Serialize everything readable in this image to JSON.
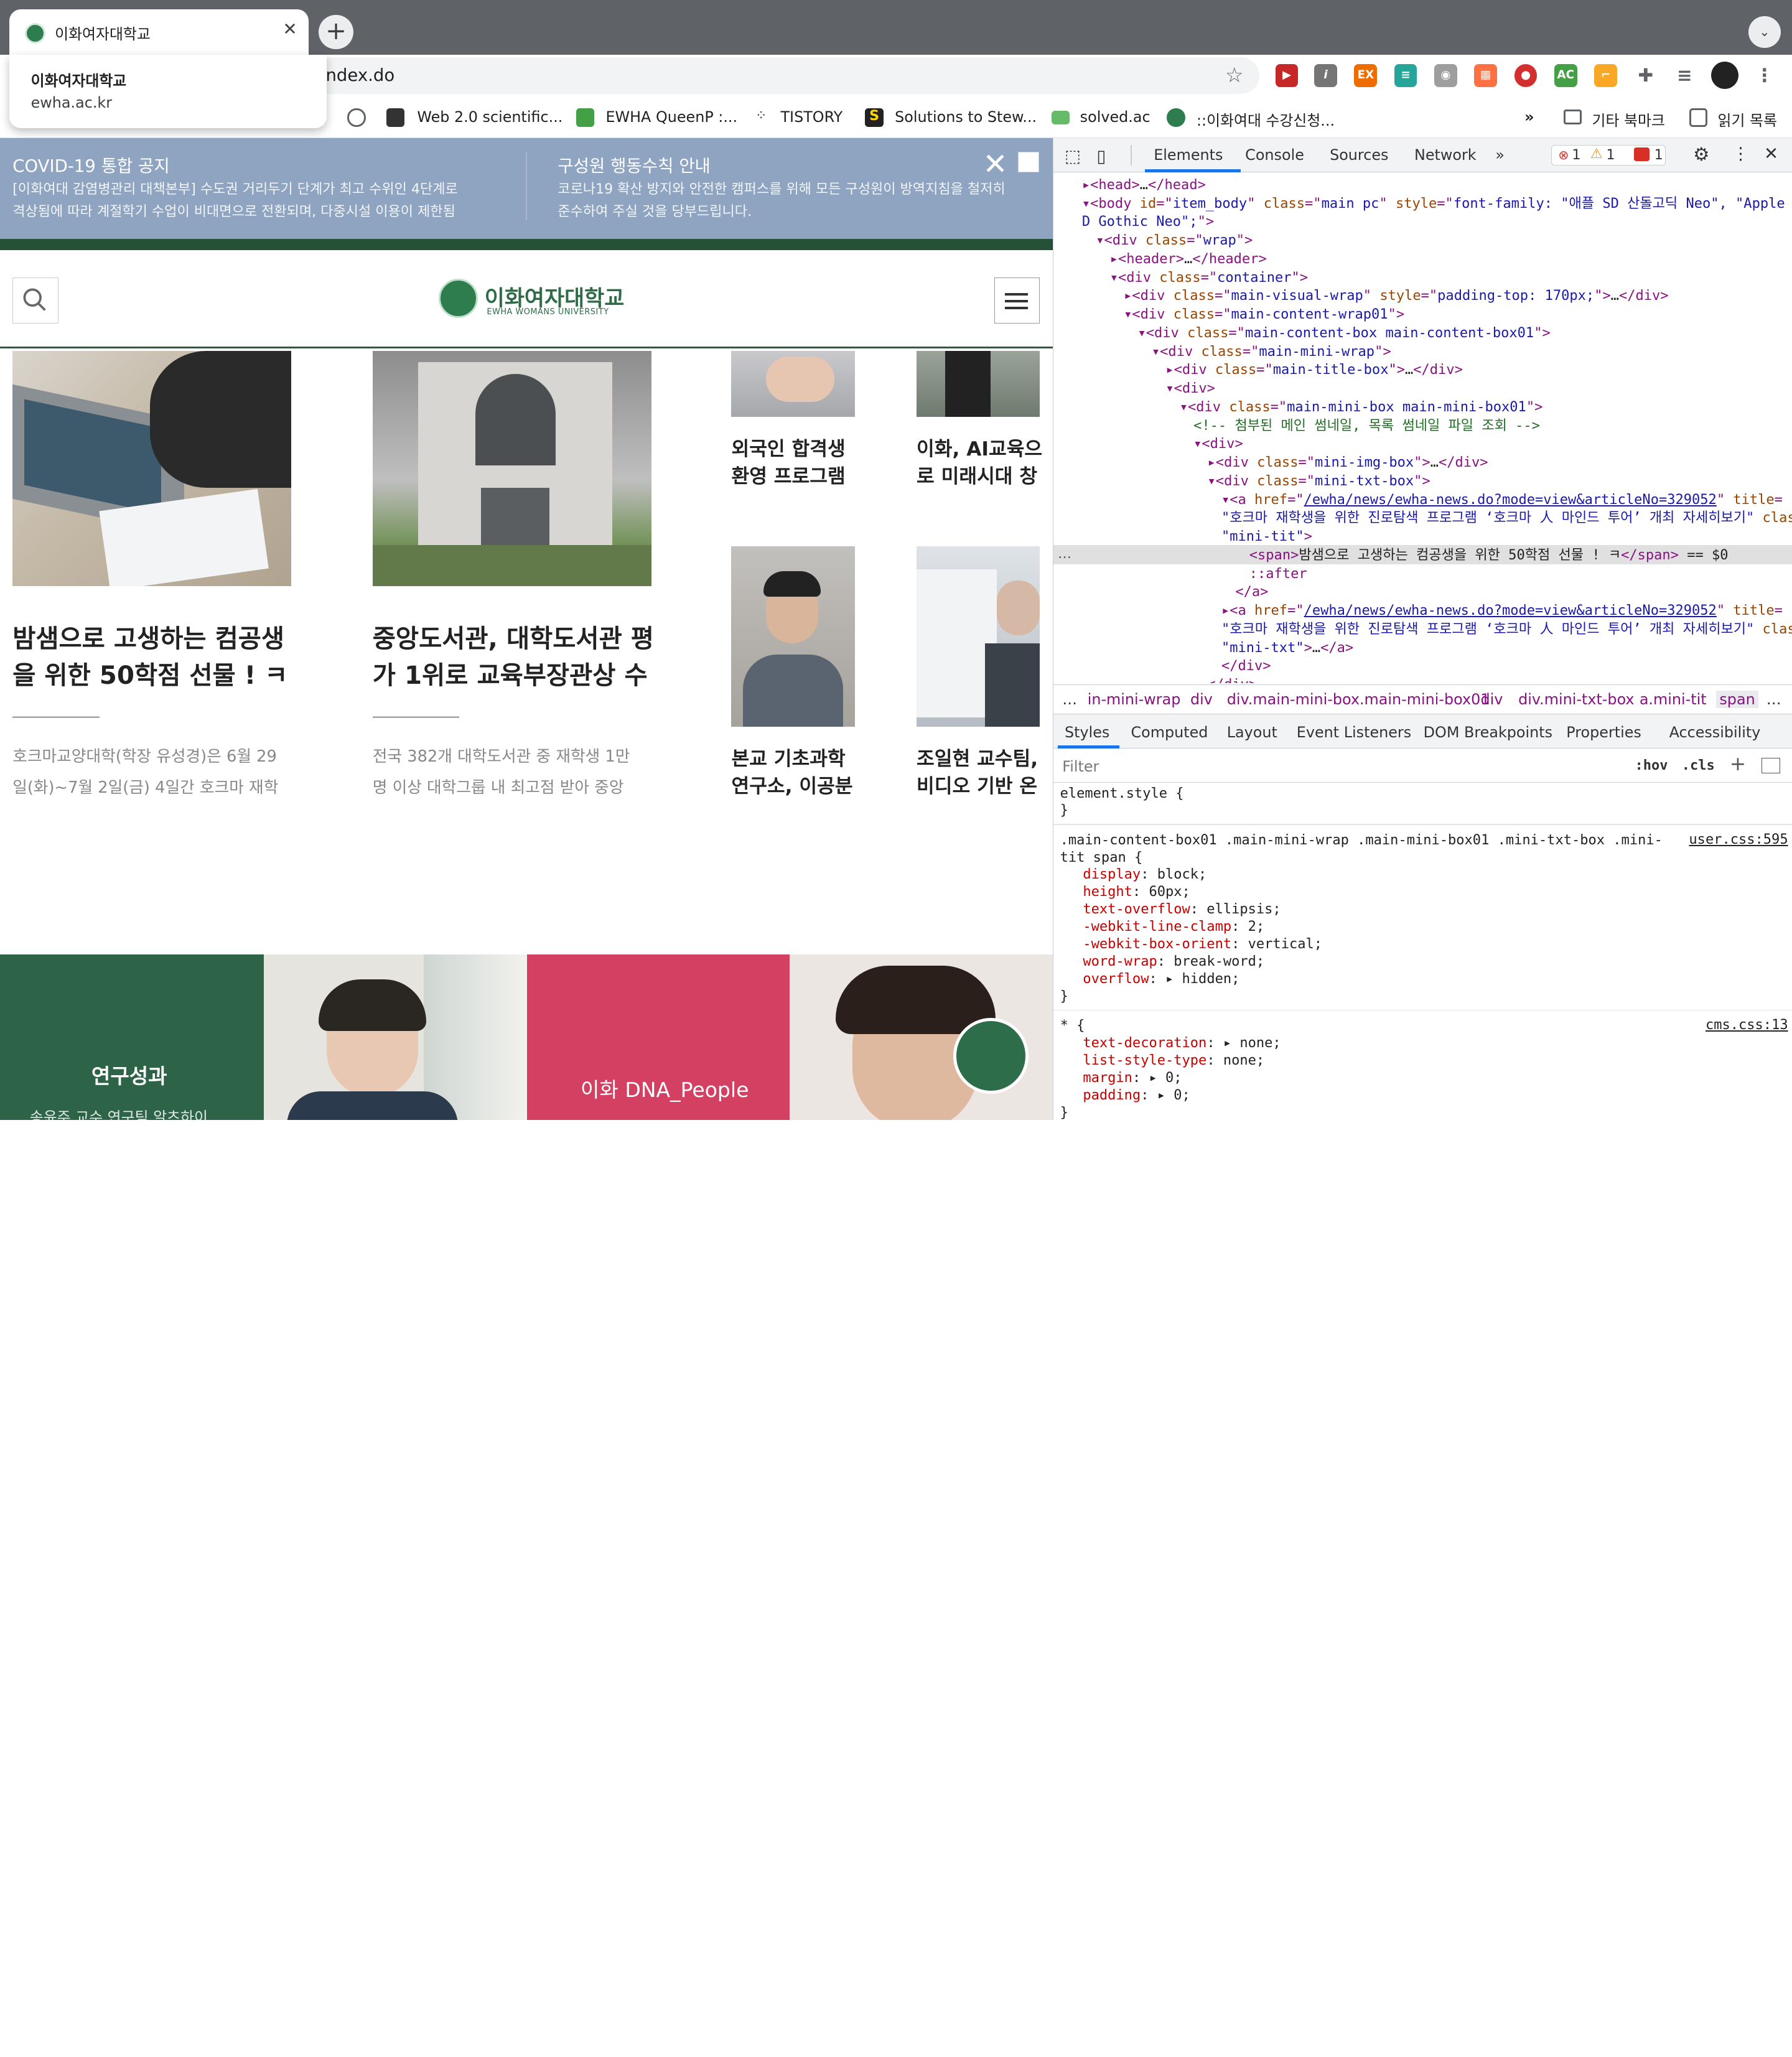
{
  "browser": {
    "tab_title": "이화여자대학교",
    "tab_close": "✕",
    "new_tab": "+",
    "tab_menu": "⌄",
    "tooltip": {
      "title": "이화여자대학교",
      "domain": "ewha.ac.kr"
    },
    "url_fragment": "ndex.do",
    "bookmarks": [
      "Web 2.0 scientific...",
      "EWHA QueenP :...",
      "TISTORY",
      "Solutions to Stew...",
      "solved.ac",
      "::이화여대 수강신청..."
    ],
    "bookmarks_more": "»",
    "other_bookmarks": "기타 북마크",
    "reading_list": "읽기 목록"
  },
  "page": {
    "notices": [
      {
        "title": "COVID-19 통합 공지",
        "text": [
          "[이화여대 감염병관리 대책본부] 수도권 거리두기 단계가 최고 수위인 4단계로",
          "격상됨에 따라 계절학기 수업이 비대면으로 전환되며, 다중시설 이용이 제한됨"
        ]
      },
      {
        "title": "구성원 행동수칙 안내",
        "text": [
          "코로나19 확산 방지와 안전한 캠퍼스를 위해 모든 구성원이 방역지침을 철저히",
          "준수하여 주실 것을 당부드립니다."
        ]
      }
    ],
    "notice_close": "✕",
    "logo_ko": "이화여자대학교",
    "logo_en": "EWHA WOMANS UNIVERSITY",
    "news_big": [
      {
        "title": [
          "밤샘으로 고생하는 컴공생",
          "을 위한 50학점 선물 ! ㅋ"
        ],
        "desc": [
          "호크마교양대학(학장 유성경)은 6월 29",
          "일(화)~7월 2일(금) 4일간 호크마 재학"
        ]
      },
      {
        "title": [
          "중앙도서관, 대학도서관 평",
          "가 1위로 교육부장관상 수"
        ],
        "desc": [
          "전국 382개 대학도서관 중 재학생 1만",
          "명 이상 대학그룹 내 최고점 받아 중앙"
        ]
      }
    ],
    "news_small": [
      {
        "title": [
          "외국인 합격생",
          "환영 프로그램"
        ]
      },
      {
        "title": [
          "이화, AI교육으",
          "로 미래시대 창"
        ]
      },
      {
        "title": [
          "본교 기초과학",
          "연구소, 이공분"
        ]
      },
      {
        "title": [
          "조일현 교수팀,",
          "비디오 기반 온"
        ]
      }
    ],
    "band_labels": [
      "연구성과",
      "이화 DNA_People"
    ],
    "band_sub": "송윤주 교수 연구팀 알츠하이"
  },
  "devtools": {
    "tabs": [
      "Elements",
      "Console",
      "Sources",
      "Network",
      "»"
    ],
    "errors": "1",
    "warnings": "1",
    "issues": "1",
    "dom": [
      {
        "indent": 1,
        "segs": [
          [
            "tg",
            "▸<head>"
          ],
          [
            "tx",
            "…"
          ],
          [
            "tg",
            "</head>"
          ]
        ]
      },
      {
        "indent": 1,
        "segs": [
          [
            "tg",
            "▾<body "
          ],
          [
            "at",
            "id"
          ],
          [
            "tg",
            "=\""
          ],
          [
            "av",
            "item_body"
          ],
          [
            "tg",
            "\" "
          ],
          [
            "at",
            "class"
          ],
          [
            "tg",
            "=\""
          ],
          [
            "av",
            "main pc"
          ],
          [
            "tg",
            "\" "
          ],
          [
            "at",
            "style"
          ],
          [
            "tg",
            "=\""
          ],
          [
            "av",
            "font-family: \"애플 SD 산돌고딕 Neo\", \"Apple S"
          ]
        ]
      },
      {
        "indent": 1,
        "segs": [
          [
            "av",
            "D Gothic Neo\";"
          ],
          [
            "tg",
            "\">"
          ]
        ]
      },
      {
        "indent": 2,
        "segs": [
          [
            "tg",
            "▾<div "
          ],
          [
            "at",
            "class"
          ],
          [
            "tg",
            "=\""
          ],
          [
            "av",
            "wrap"
          ],
          [
            "tg",
            "\">"
          ]
        ]
      },
      {
        "indent": 3,
        "segs": [
          [
            "tg",
            "▸<header>"
          ],
          [
            "tx",
            "…"
          ],
          [
            "tg",
            "</header>"
          ]
        ]
      },
      {
        "indent": 3,
        "segs": [
          [
            "tg",
            "▾<div "
          ],
          [
            "at",
            "class"
          ],
          [
            "tg",
            "=\""
          ],
          [
            "av",
            "container"
          ],
          [
            "tg",
            "\">"
          ]
        ]
      },
      {
        "indent": 4,
        "segs": [
          [
            "tg",
            "▸<div "
          ],
          [
            "at",
            "class"
          ],
          [
            "tg",
            "=\""
          ],
          [
            "av",
            "main-visual-wrap"
          ],
          [
            "tg",
            "\" "
          ],
          [
            "at",
            "style"
          ],
          [
            "tg",
            "=\""
          ],
          [
            "av",
            "padding-top: 170px;"
          ],
          [
            "tg",
            "\">"
          ],
          [
            "tx",
            "…"
          ],
          [
            "tg",
            "</div>"
          ]
        ]
      },
      {
        "indent": 4,
        "segs": [
          [
            "tg",
            "▾<div "
          ],
          [
            "at",
            "class"
          ],
          [
            "tg",
            "=\""
          ],
          [
            "av",
            "main-content-wrap01"
          ],
          [
            "tg",
            "\">"
          ]
        ]
      },
      {
        "indent": 5,
        "segs": [
          [
            "tg",
            "▾<div "
          ],
          [
            "at",
            "class"
          ],
          [
            "tg",
            "=\""
          ],
          [
            "av",
            "main-content-box main-content-box01"
          ],
          [
            "tg",
            "\">"
          ]
        ]
      },
      {
        "indent": 6,
        "segs": [
          [
            "tg",
            "▾<div "
          ],
          [
            "at",
            "class"
          ],
          [
            "tg",
            "=\""
          ],
          [
            "av",
            "main-mini-wrap"
          ],
          [
            "tg",
            "\">"
          ]
        ]
      },
      {
        "indent": 7,
        "segs": [
          [
            "tg",
            "▸<div "
          ],
          [
            "at",
            "class"
          ],
          [
            "tg",
            "=\""
          ],
          [
            "av",
            "main-title-box"
          ],
          [
            "tg",
            "\">"
          ],
          [
            "tx",
            "…"
          ],
          [
            "tg",
            "</div>"
          ]
        ]
      },
      {
        "indent": 7,
        "segs": [
          [
            "tg",
            "▾<div>"
          ]
        ]
      },
      {
        "indent": 8,
        "segs": [
          [
            "tg",
            "▾<div "
          ],
          [
            "at",
            "class"
          ],
          [
            "tg",
            "=\""
          ],
          [
            "av",
            "main-mini-box main-mini-box01"
          ],
          [
            "tg",
            "\">"
          ]
        ]
      },
      {
        "indent": 9,
        "segs": [
          [
            "cm",
            "<!-- 첨부된 메인 썸네일, 목록 썸네일 파일 조회  -->"
          ]
        ]
      },
      {
        "indent": 9,
        "segs": [
          [
            "tg",
            "▾<div>"
          ]
        ]
      },
      {
        "indent": 10,
        "segs": [
          [
            "tg",
            "▸<div "
          ],
          [
            "at",
            "class"
          ],
          [
            "tg",
            "=\""
          ],
          [
            "av",
            "mini-img-box"
          ],
          [
            "tg",
            "\">"
          ],
          [
            "tx",
            "…"
          ],
          [
            "tg",
            "</div>"
          ]
        ]
      },
      {
        "indent": 10,
        "segs": [
          [
            "tg",
            "▾<div "
          ],
          [
            "at",
            "class"
          ],
          [
            "tg",
            "=\""
          ],
          [
            "av",
            "mini-txt-box"
          ],
          [
            "tg",
            "\">"
          ]
        ]
      },
      {
        "indent": 11,
        "segs": [
          [
            "tg",
            "▾<a "
          ],
          [
            "at",
            "href"
          ],
          [
            "tg",
            "=\""
          ],
          [
            "ln",
            "/ewha/news/ewha-news.do?mode=view&articleNo=329052"
          ],
          [
            "tg",
            "\" "
          ],
          [
            "at",
            "title"
          ],
          [
            "tg",
            "="
          ]
        ]
      },
      {
        "indent": 11,
        "segs": [
          [
            "av",
            "\"호크마 재학생을 위한 진로탐색 프로그램 ‘호크마 人 마인드 투어’ 개최 자세히보기\""
          ],
          [
            "tg",
            " "
          ],
          [
            "at",
            "class"
          ],
          [
            "tg",
            "="
          ]
        ]
      },
      {
        "indent": 11,
        "segs": [
          [
            "av",
            "\"mini-tit\""
          ],
          [
            "tg",
            ">"
          ]
        ]
      },
      {
        "indent": 13,
        "segs": [
          [
            "tg",
            "<span>"
          ],
          [
            "tx",
            "밤샘으로 고생하는 컴공생을 위한 50학점 선물 ! ㅋ"
          ],
          [
            "tg",
            "</span>"
          ],
          [
            "tx",
            " == $0"
          ]
        ]
      },
      {
        "indent": 13,
        "segs": [
          [
            "tg",
            "::after"
          ]
        ]
      },
      {
        "indent": 12,
        "segs": [
          [
            "tg",
            "</a>"
          ]
        ]
      },
      {
        "indent": 11,
        "segs": [
          [
            "tg",
            "▸<a "
          ],
          [
            "at",
            "href"
          ],
          [
            "tg",
            "=\""
          ],
          [
            "ln",
            "/ewha/news/ewha-news.do?mode=view&articleNo=329052"
          ],
          [
            "tg",
            "\" "
          ],
          [
            "at",
            "title"
          ],
          [
            "tg",
            "="
          ]
        ]
      },
      {
        "indent": 11,
        "segs": [
          [
            "av",
            "\"호크마 재학생을 위한 진로탐색 프로그램 ‘호크마 人 마인드 투어’ 개최 자세히보기\""
          ],
          [
            "tg",
            " "
          ],
          [
            "at",
            "class"
          ],
          [
            "tg",
            "="
          ]
        ]
      },
      {
        "indent": 11,
        "segs": [
          [
            "av",
            "\"mini-txt\""
          ],
          [
            "tg",
            ">"
          ],
          [
            "tx",
            "…"
          ],
          [
            "tg",
            "</a>"
          ]
        ]
      },
      {
        "indent": 11,
        "segs": [
          [
            "tg",
            "</div>"
          ]
        ]
      },
      {
        "indent": 10,
        "segs": [
          [
            "tg",
            "</div>"
          ]
        ]
      }
    ],
    "ellipsis_marker": "…",
    "breadcrumbs": [
      "…",
      "in-mini-wrap",
      "div",
      "div.main-mini-box.main-mini-box01",
      "div",
      "div.mini-txt-box",
      "a.mini-tit",
      "span",
      "…"
    ],
    "subtabs": [
      "Styles",
      "Computed",
      "Layout",
      "Event Listeners",
      "DOM Breakpoints",
      "Properties",
      "Accessibility"
    ],
    "filter_placeholder": "Filter",
    "hov": ":hov",
    "cls": ".cls",
    "rules": [
      {
        "selector": [
          "element.style {"
        ],
        "props": [],
        "source": ""
      },
      {
        "selector": [
          ".main-content-box01 .main-mini-wrap .main-mini-box01 .mini-txt-box .mini-",
          "tit span {"
        ],
        "props": [
          [
            "display",
            "block;"
          ],
          [
            "height",
            "60px;"
          ],
          [
            "text-overflow",
            "ellipsis;"
          ],
          [
            "-webkit-line-clamp",
            "2;"
          ],
          [
            "-webkit-box-orient",
            "vertical;"
          ],
          [
            "word-wrap",
            "break-word;"
          ],
          [
            "overflow",
            "▸ hidden;"
          ]
        ],
        "source": "user.css:595"
      },
      {
        "selector": [
          "* {"
        ],
        "props": [
          [
            "text-decoration",
            "▸ none;"
          ],
          [
            "list-style-type",
            "none;"
          ],
          [
            "margin",
            "▸ 0;"
          ],
          [
            "padding",
            "▸ 0;"
          ]
        ],
        "source": "cms.css:13"
      }
    ],
    "close_brace": "}"
  },
  "colors": {
    "ewha_green": "#245138",
    "notice_blue": "#8ea4c0",
    "dna_pink": "#d44062",
    "devtools_tag": "#881280"
  }
}
